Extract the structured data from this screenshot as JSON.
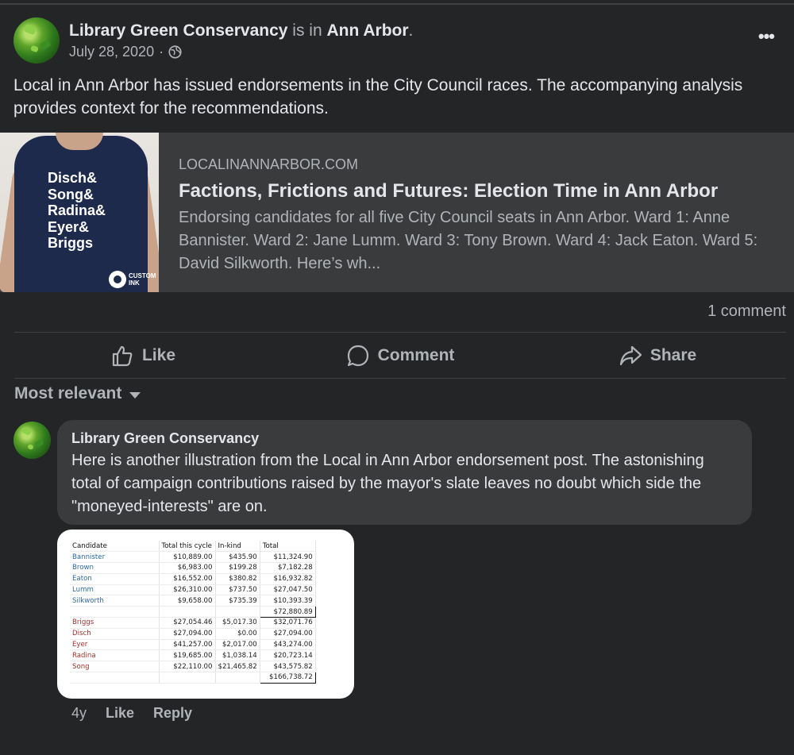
{
  "post": {
    "author": "Library Green Conservancy",
    "connector": "is in",
    "place": "Ann Arbor",
    "period": ".",
    "date": "July 28, 2020",
    "date_sep": "·",
    "privacy_icon": "globe-icon",
    "more_icon": "more-dots-icon",
    "text": "Local in Ann Arbor has issued endorsements in the City Council races. The accompanying analysis provides context for the recommendations."
  },
  "link_card": {
    "domain": "LOCALINANNARBOR.COM",
    "title": "Factions, Frictions and Futures: Election Time in Ann Arbor",
    "description": " Endorsing candidates for all five City Council seats in Ann Arbor. Ward 1: Anne Bannister. Ward 2: Jane Lumm. Ward 3: Tony Brown. Ward 4: Jack Eaton. Ward 5: David Silkworth. Here’s wh...",
    "shirt_lines": [
      "Disch&",
      "Song&",
      "Radina&",
      "Eyer&",
      "Briggs"
    ],
    "shirt_brand": [
      "CUSTOM",
      "INK"
    ]
  },
  "stats": {
    "comments": "1 comment"
  },
  "actions": {
    "like": "Like",
    "comment": "Comment",
    "share": "Share"
  },
  "sort": {
    "label": "Most relevant"
  },
  "comment": {
    "author": "Library Green Conservancy",
    "text": "Here is another illustration from the Local in Ann Arbor endorsement post. The astonishing total of campaign contributions raised by the mayor's slate leaves no doubt which side the \"moneyed-interests\" are on.",
    "age": "4y",
    "like": "Like",
    "reply": "Reply"
  },
  "spreadsheet": {
    "headers": [
      "Candidate",
      "Total this cycle",
      "In-kind",
      "Total"
    ],
    "group1": [
      [
        "Bannister",
        "$10,889.00",
        "$435.90",
        "$11,324.90"
      ],
      [
        "Brown",
        "$6,983.00",
        "$199.28",
        "$7,182.28"
      ],
      [
        "Eaton",
        "$16,552.00",
        "$380.82",
        "$16,932.82"
      ],
      [
        "Lumm",
        "$26,310.00",
        "$737.50",
        "$27,047.50"
      ],
      [
        "Silkworth",
        "$9,658.00",
        "$735.39",
        "$10,393.39"
      ]
    ],
    "group1_total": "$72,880.89",
    "group2": [
      [
        "Briggs",
        "$27,054.46",
        "$5,017.30",
        "$32,071.76"
      ],
      [
        "Disch",
        "$27,094.00",
        "$0.00",
        "$27,094.00"
      ],
      [
        "Eyer",
        "$41,257.00",
        "$2,017.00",
        "$43,274.00"
      ],
      [
        "Radina",
        "$19,685.00",
        "$1,038.14",
        "$20,723.14"
      ],
      [
        "Song",
        "$22,110.00",
        "$21,465.82",
        "$43,575.82"
      ]
    ],
    "group2_total": "$166,738.72"
  }
}
